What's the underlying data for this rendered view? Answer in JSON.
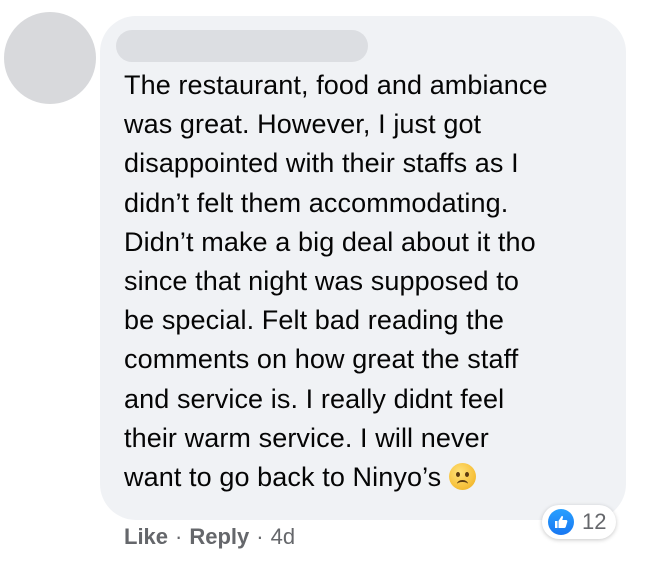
{
  "comment": {
    "text": "The restaurant, food and ambiance\nwas great. However, I just got\ndisappointed with their staffs as I\ndidn’t felt them accommodating.\nDidn’t make a big deal about it tho\nsince that night was supposed to\nbe special. Felt bad reading the\ncomments on how great the staff\nand service is. I really didnt feel\ntheir warm service. I will never\nwant to go back to Ninyo’s",
    "emoji": "frowning-face-emoji"
  },
  "reactions": {
    "icon": "thumbs-up-icon",
    "count": "12",
    "color": "#1877f2"
  },
  "actions": {
    "like_label": "Like",
    "reply_label": "Reply",
    "separator": "·",
    "timestamp": "4d"
  },
  "colors": {
    "bubble": "#f0f2f5",
    "text": "#050505",
    "meta": "#65676b",
    "avatar_placeholder": "#d8d9dc"
  }
}
